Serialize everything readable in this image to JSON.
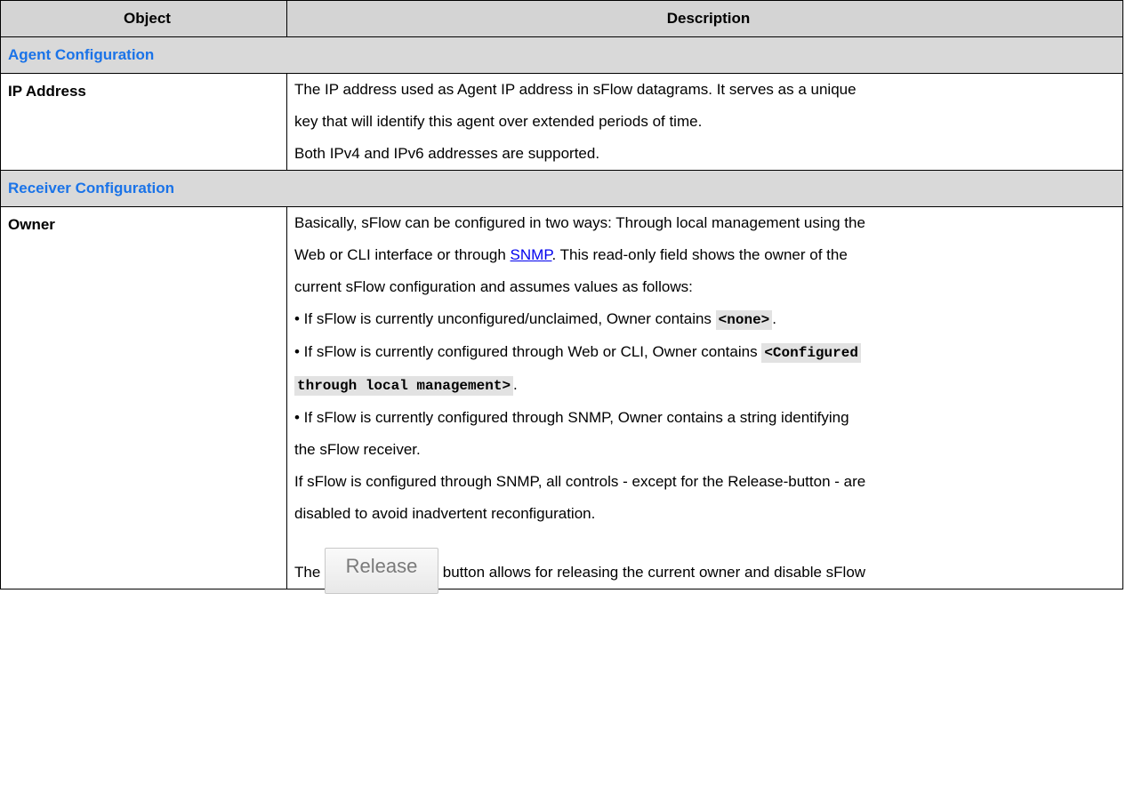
{
  "table": {
    "col_object": "Object",
    "col_description": "Description"
  },
  "agent": {
    "section": "Agent Configuration",
    "ip": {
      "label": "IP Address",
      "line1": "The IP address used as Agent IP address in sFlow datagrams. It serves as a unique",
      "line2": "key that will identify this agent over extended periods of time.",
      "line3": "Both IPv4 and IPv6 addresses are supported."
    }
  },
  "receiver": {
    "section": "Receiver Configuration",
    "owner": {
      "label": "Owner",
      "p1a": "Basically, sFlow can be configured in two ways: Through local management using the",
      "p1b_pre": "Web or CLI interface or through ",
      "snmp_link": "SNMP",
      "p1b_post": ". This read-only field shows the owner of the",
      "p1c": "current sFlow configuration and assumes values as follows:",
      "b1_pre": "• If sFlow is currently unconfigured/unclaimed, Owner contains ",
      "b1_code": "<none>",
      "b1_post": ".",
      "b2_pre": "• If sFlow is currently configured through Web or CLI, Owner contains ",
      "b2_code1": "<Configured",
      "b2_code2": "through local management>",
      "b2_post": ".",
      "b3a": "• If sFlow is currently configured through SNMP, Owner contains a string identifying",
      "b3b": "the sFlow receiver.",
      "p2a": "If sFlow is configured through SNMP, all controls - except for the Release-button - are",
      "p2b": "disabled to avoid inadvertent reconfiguration.",
      "p3_pre": "The ",
      "release_button": "Release",
      "p3_post": " button allows for releasing the current owner and disable sFlow"
    }
  }
}
